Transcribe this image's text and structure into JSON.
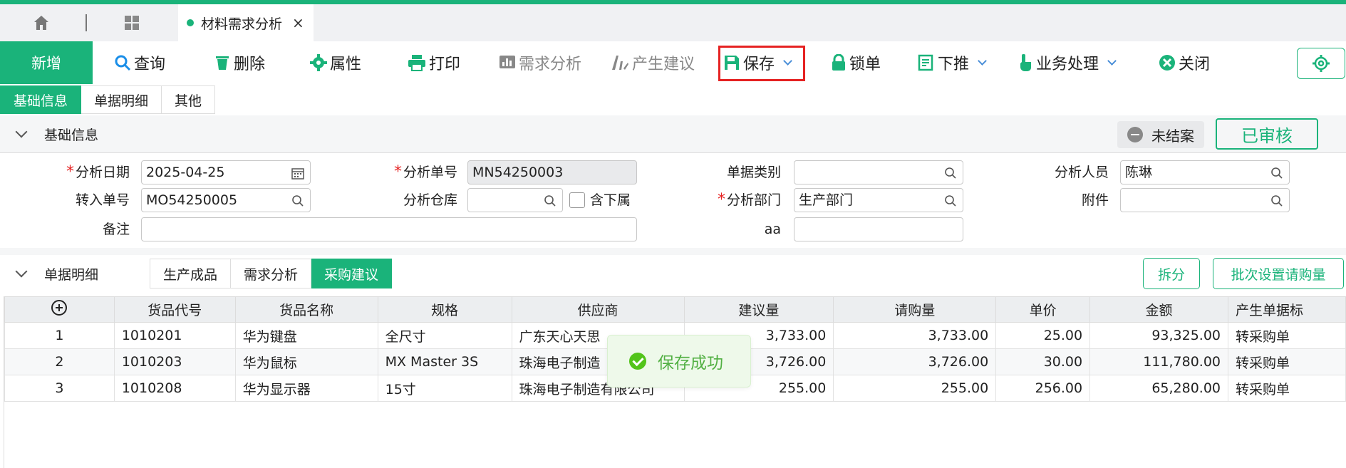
{
  "tabs": {
    "active_label": "材料需求分析"
  },
  "toolbar": {
    "new": "新增",
    "query": "查询",
    "delete": "删除",
    "props": "属性",
    "print": "打印",
    "demand": "需求分析",
    "suggest": "产生建议",
    "save": "保存",
    "lock": "锁单",
    "push": "下推",
    "business": "业务处理",
    "close": "关闭"
  },
  "subtabs": [
    "基础信息",
    "单据明细",
    "其他"
  ],
  "basic": {
    "title": "基础信息",
    "status_open": "未结案",
    "status_approved": "已审核",
    "labels": {
      "date": "分析日期",
      "no": "分析单号",
      "category": "单据类别",
      "person": "分析人员",
      "transfer": "转入单号",
      "warehouse": "分析仓库",
      "sub": "含下属",
      "dept": "分析部门",
      "attach": "附件",
      "remark": "备注",
      "aa": "aa"
    },
    "values": {
      "date": "2025-04-25",
      "no": "MN54250003",
      "category": "",
      "person": "陈琳",
      "transfer": "MO54250005",
      "warehouse": "",
      "dept": "生产部门",
      "attach": "",
      "remark": "",
      "aa": ""
    }
  },
  "detail": {
    "title": "单据明细",
    "tabs": [
      "生产成品",
      "需求分析",
      "采购建议"
    ],
    "split": "拆分",
    "batch": "批次设置请购量",
    "columns": [
      "货品代号",
      "货品名称",
      "规格",
      "供应商",
      "建议量",
      "请购量",
      "单价",
      "金额",
      "产生单据标"
    ],
    "rows": [
      {
        "idx": "1",
        "code": "1010201",
        "name": "华为键盘",
        "spec": "全尺寸",
        "supplier": "广东天心天思",
        "suggest": "3,733.00",
        "request": "3,733.00",
        "price": "25.00",
        "amount": "93,325.00",
        "flag": "转采购单"
      },
      {
        "idx": "2",
        "code": "1010203",
        "name": "华为鼠标",
        "spec": "MX Master 3S",
        "supplier": "珠海电子制造",
        "suggest": "3,726.00",
        "request": "3,726.00",
        "price": "30.00",
        "amount": "111,780.00",
        "flag": "转采购单"
      },
      {
        "idx": "3",
        "code": "1010208",
        "name": "华为显示器",
        "spec": "15寸",
        "supplier": "珠海电子制造有限公司",
        "suggest": "255.00",
        "request": "255.00",
        "price": "256.00",
        "amount": "65,280.00",
        "flag": "转采购单"
      }
    ]
  },
  "toast": {
    "message": "保存成功"
  },
  "colors": {
    "accent": "#1ab37a",
    "danger": "#e52222",
    "success": "#52c41a"
  }
}
